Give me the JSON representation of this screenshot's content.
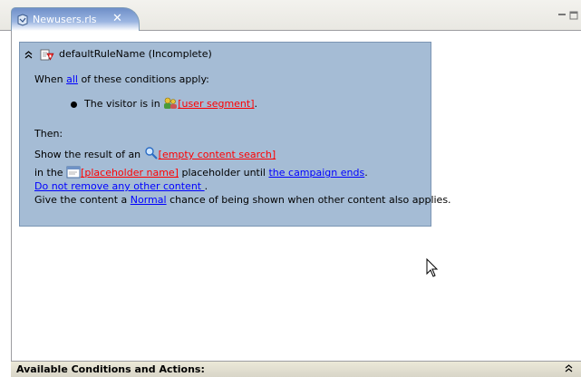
{
  "tab": {
    "title": "Newusers.rls",
    "close_glyph": "✕",
    "icon": "rule-file-icon"
  },
  "window_controls": {
    "minimize_icon": "minimize-icon",
    "maximize_icon": "maximize-icon"
  },
  "rule": {
    "name": "defaultRuleName (Incomplete)",
    "collapse_glyph": "≈",
    "when_prefix": "When ",
    "when_link": "all",
    "when_suffix": " of these conditions apply:",
    "condition_prefix": "The visitor is in ",
    "condition_link": "[user segment]",
    "condition_suffix": ".",
    "then_label": "Then:",
    "action1_prefix": "Show the result of an ",
    "action1_link": "[empty content search]",
    "action2_prefix": "in the ",
    "action2_link": "[placeholder name]",
    "action2_middle": " placeholder until ",
    "action2_link2": "the campaign ends",
    "action2_suffix": ".",
    "action3_link": "Do not remove any other content ",
    "action3_suffix": ".",
    "action4_prefix": "Give the content a ",
    "action4_link": "Normal",
    "action4_suffix": " chance of being shown when other content also applies."
  },
  "bottom_panel": {
    "title": "Available Conditions and Actions:",
    "expand_glyph": "≈"
  },
  "colors": {
    "rule_background": "#a5bcd5",
    "link_blue": "#0000ff",
    "link_red": "#ff0000",
    "tab_blue": "#6f8fc8"
  }
}
